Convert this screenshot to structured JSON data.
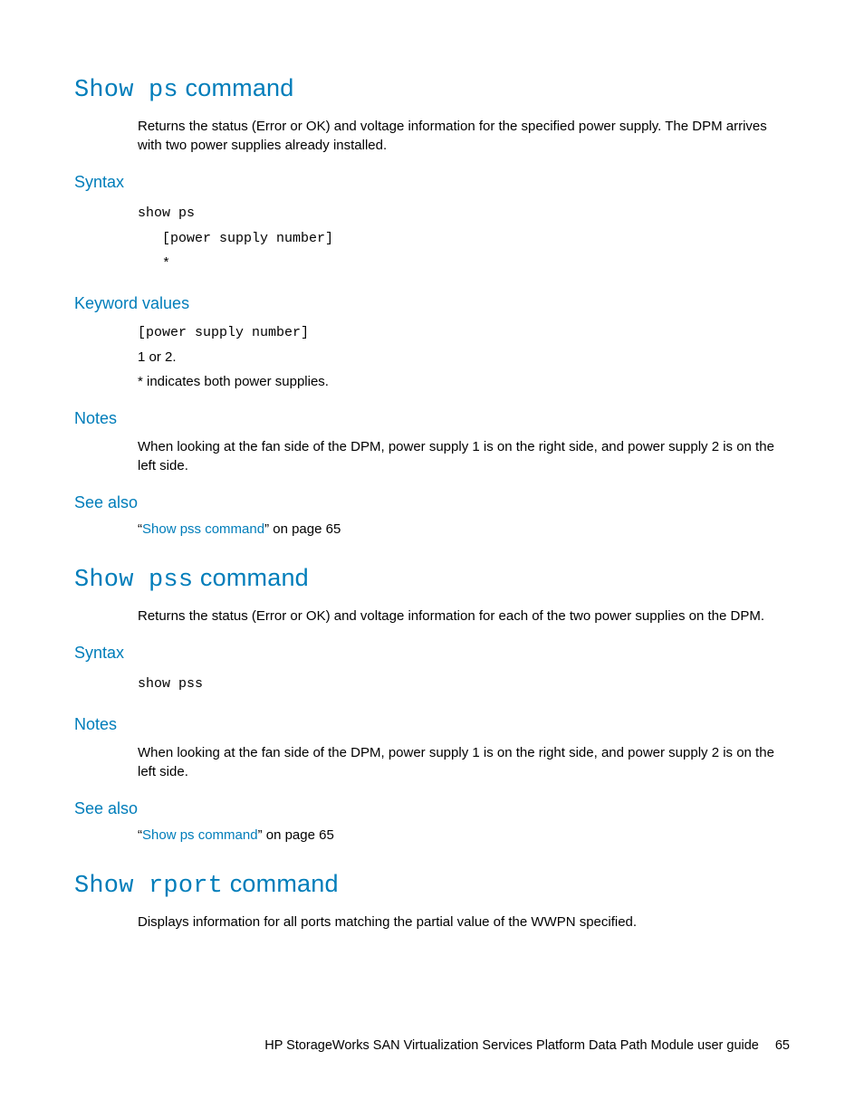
{
  "sec1": {
    "title_mono": "Show ps",
    "title_rest": " command",
    "desc": "Returns the status (Error or OK) and voltage information for the specified power supply. The DPM arrives with two power supplies already installed.",
    "syntax_h": "Syntax",
    "syntax_code": "show ps\n   [power supply number]\n   *",
    "kv_h": "Keyword values",
    "kv_code": "[power supply number]",
    "kv_l1": "1 or 2.",
    "kv_l2": "* indicates both power supplies.",
    "notes_h": "Notes",
    "notes_body": "When looking at the fan side of the DPM, power supply 1 is on the right side, and power supply 2 is on the left side.",
    "seealso_h": "See also",
    "seealso_q1": "“",
    "seealso_link": "Show pss command",
    "seealso_rest": "” on page 65"
  },
  "sec2": {
    "title_mono": "Show pss",
    "title_rest": " command",
    "desc": "Returns the status (Error or OK) and voltage information for each of the two power supplies on the DPM.",
    "syntax_h": "Syntax",
    "syntax_code": "show pss",
    "notes_h": "Notes",
    "notes_body": "When looking at the fan side of the DPM, power supply 1 is on the right side, and power supply 2 is on the left side.",
    "seealso_h": "See also",
    "seealso_q1": "“",
    "seealso_link": "Show ps command",
    "seealso_rest": "” on page 65"
  },
  "sec3": {
    "title_mono": "Show rport",
    "title_rest": " command",
    "desc": "Displays information for all ports matching the partial value of the WWPN specified."
  },
  "footer": {
    "text": "HP StorageWorks SAN Virtualization Services Platform Data Path Module user guide",
    "page": "65"
  }
}
